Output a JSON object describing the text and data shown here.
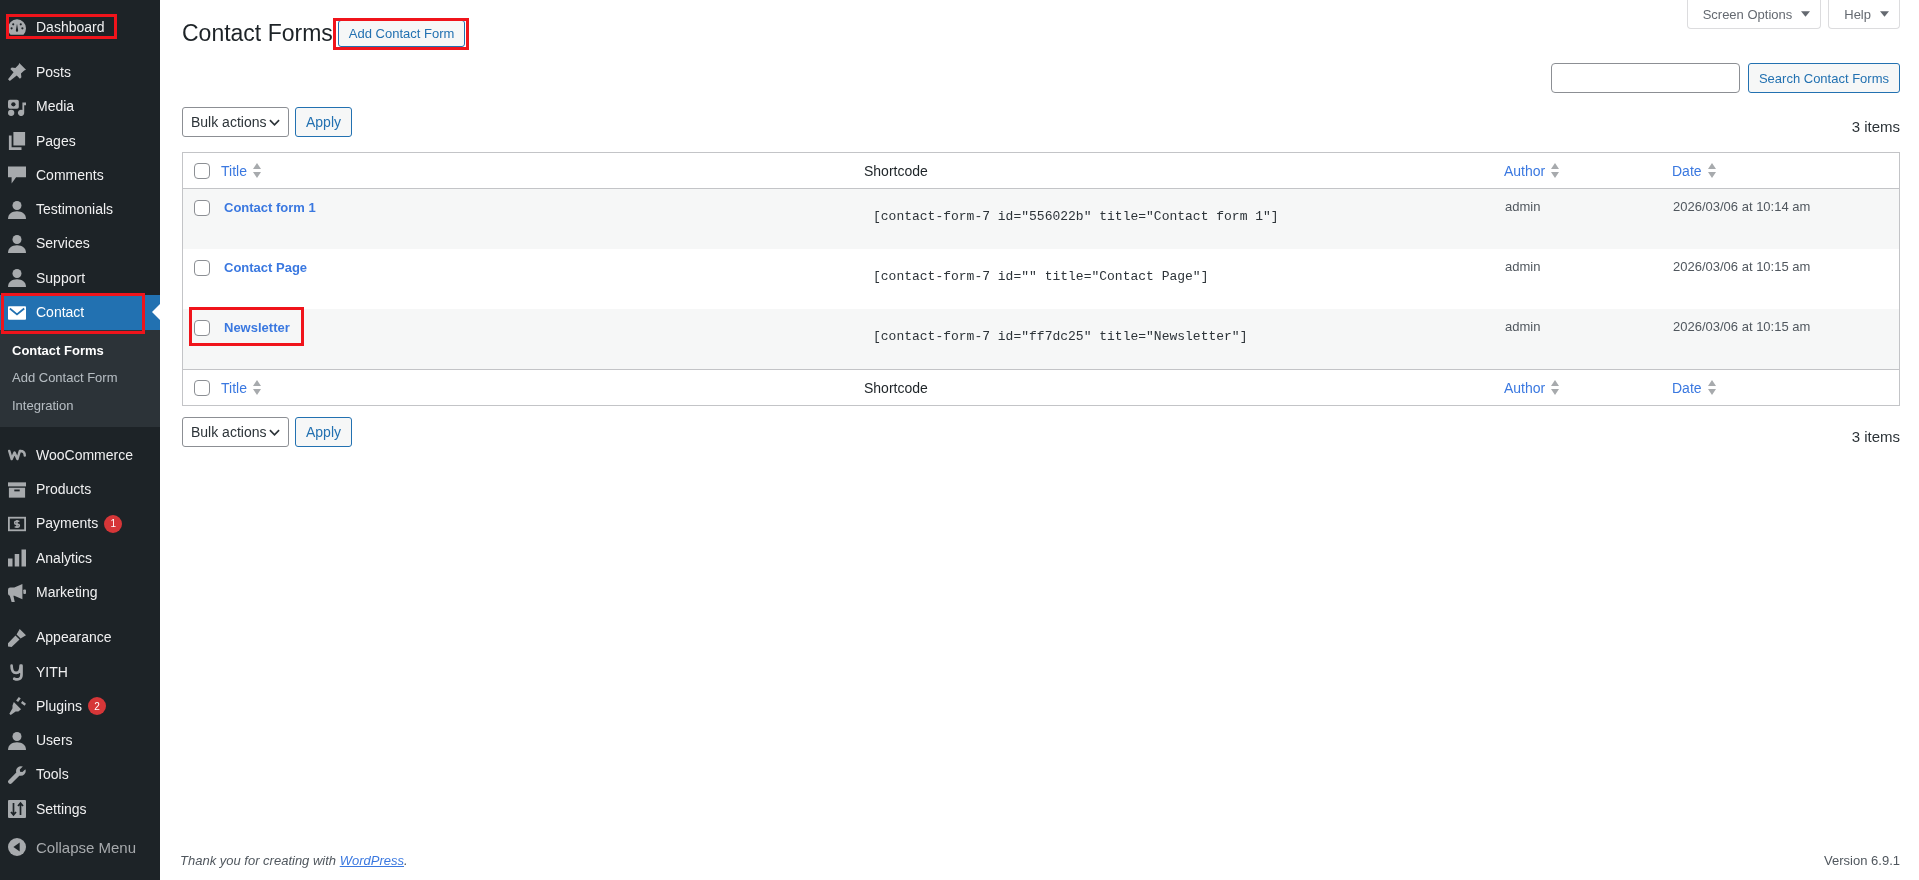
{
  "screen_meta": {
    "tabs": [
      {
        "label": "Screen Options"
      },
      {
        "label": "Help"
      }
    ]
  },
  "sidebar": {
    "groups": [
      {
        "items": [
          {
            "label": "Dashboard",
            "selected": false,
            "highlighted": true
          }
        ]
      },
      {
        "items": [
          {
            "label": "Posts",
            "selected": false,
            "highlighted": false
          },
          {
            "label": "Media",
            "selected": false,
            "highlighted": false
          },
          {
            "label": "Pages",
            "selected": false,
            "highlighted": false
          },
          {
            "label": "Comments",
            "selected": false,
            "highlighted": false
          },
          {
            "label": "Testimonials",
            "selected": false,
            "highlighted": false
          },
          {
            "label": "Services",
            "selected": false,
            "highlighted": false
          },
          {
            "label": "Support",
            "selected": false,
            "highlighted": false
          },
          {
            "label": "Contact",
            "selected": true,
            "highlighted": true,
            "children": [
              {
                "label": "Contact Forms",
                "selected": true
              },
              {
                "label": "Add Contact Form",
                "selected": false
              },
              {
                "label": "Integration",
                "selected": false
              }
            ]
          }
        ]
      },
      {
        "items": [
          {
            "label": "WooCommerce",
            "selected": false,
            "highlighted": false
          },
          {
            "label": "Products",
            "selected": false,
            "highlighted": false
          },
          {
            "label": "Payments",
            "selected": false,
            "highlighted": false,
            "badge": "1"
          },
          {
            "label": "Analytics",
            "selected": false,
            "highlighted": false
          },
          {
            "label": "Marketing",
            "selected": false,
            "highlighted": false
          }
        ]
      },
      {
        "items": [
          {
            "label": "Appearance",
            "selected": false,
            "highlighted": false
          },
          {
            "label": "YITH",
            "selected": false,
            "highlighted": false
          },
          {
            "label": "Plugins",
            "selected": false,
            "highlighted": false,
            "badge": "2"
          },
          {
            "label": "Users",
            "selected": false,
            "highlighted": false
          },
          {
            "label": "Tools",
            "selected": false,
            "highlighted": false
          },
          {
            "label": "Settings",
            "selected": false,
            "highlighted": false
          }
        ]
      }
    ],
    "collapse_label": "Collapse Menu"
  },
  "header": {
    "title": "Contact Forms",
    "add_button": {
      "label": "Add Contact Form",
      "highlighted": true
    }
  },
  "search": {
    "button": "Search Contact Forms"
  },
  "tablenav_top": {
    "bulk_action": "Bulk actions",
    "apply": "Apply",
    "count": "3 items"
  },
  "table": {
    "header_row": {
      "checked": false,
      "columns": [
        {
          "label": "Title",
          "sortable": true
        },
        {
          "label": "Shortcode",
          "sortable": false
        },
        {
          "label": "Author",
          "sortable": true
        },
        {
          "label": "Date",
          "sortable": true
        }
      ]
    },
    "rows": [
      {
        "title": "Contact form 1",
        "shortcode": "[contact-form-7 id=\"556022b\" title=\"Contact form 1\"]",
        "author": "admin",
        "date": "2026/03/06 at 10:14 am",
        "checked": false,
        "highlighted": false
      },
      {
        "title": "Contact Page",
        "shortcode": "[contact-form-7 id=\"\" title=\"Contact Page\"]",
        "author": "admin",
        "date": "2026/03/06 at 10:15 am",
        "checked": false,
        "highlighted": false
      },
      {
        "title": "Newsletter",
        "shortcode": "[contact-form-7 id=\"ff7dc25\" title=\"Newsletter\"]",
        "author": "admin",
        "date": "2026/03/06 at 10:15 am",
        "checked": false,
        "highlighted": true
      }
    ],
    "footer_row": {
      "checked": false,
      "columns": [
        {
          "label": "Title",
          "sortable": true
        },
        {
          "label": "Shortcode",
          "sortable": false
        },
        {
          "label": "Author",
          "sortable": true
        },
        {
          "label": "Date",
          "sortable": true
        }
      ]
    }
  },
  "tablenav_bottom": {
    "bulk_action": "Bulk actions",
    "apply": "Apply",
    "count": "3 items"
  },
  "footer": {
    "credit_before": "Thank you for creating with ",
    "credit_link": "WordPress",
    "credit_after": ".",
    "version": "Version 6.9.1"
  }
}
